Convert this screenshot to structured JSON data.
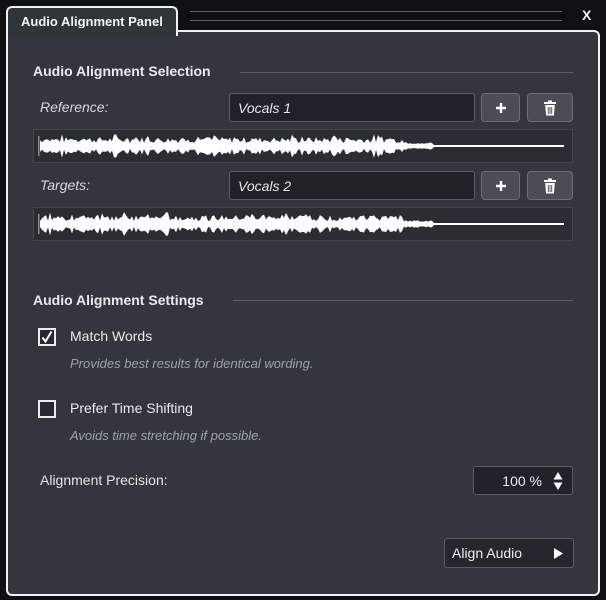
{
  "window": {
    "tab_title": "Audio Alignment Panel",
    "close_label": "X"
  },
  "selection": {
    "title": "Audio Alignment Selection",
    "reference": {
      "label": "Reference:",
      "value": "Vocals 1",
      "add_icon": "plus-icon",
      "remove_icon": "trash-icon"
    },
    "targets": {
      "label": "Targets:",
      "value": "Vocals 2",
      "add_icon": "plus-icon",
      "remove_icon": "trash-icon"
    }
  },
  "settings": {
    "title": "Audio Alignment Settings",
    "match_words": {
      "label": "Match Words",
      "checked": true,
      "hint": "Provides best results for identical wording."
    },
    "prefer_time_shifting": {
      "label": "Prefer Time Shifting",
      "checked": false,
      "hint": "Avoids time stretching if possible."
    },
    "precision": {
      "label": "Alignment Precision:",
      "value": "100 %"
    }
  },
  "actions": {
    "align_label": "Align Audio",
    "align_icon": "play-arrow-icon"
  },
  "colors": {
    "panel_bg": "#33373d",
    "field_bg": "#1f2226",
    "border_white": "#f2f2f2",
    "waveform": "#ffffff"
  }
}
